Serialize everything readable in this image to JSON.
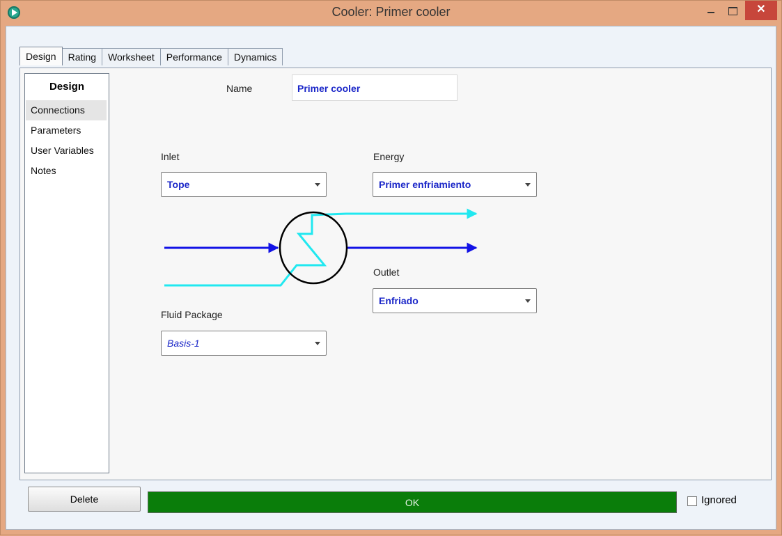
{
  "window": {
    "title": "Cooler: Primer cooler",
    "close_glyph": "✕"
  },
  "tabs": [
    {
      "label": "Design",
      "active": true
    },
    {
      "label": "Rating"
    },
    {
      "label": "Worksheet"
    },
    {
      "label": "Performance"
    },
    {
      "label": "Dynamics"
    }
  ],
  "nav": {
    "header": "Design",
    "items": [
      {
        "label": "Connections",
        "selected": true
      },
      {
        "label": "Parameters"
      },
      {
        "label": "User Variables"
      },
      {
        "label": "Notes"
      }
    ]
  },
  "form": {
    "name_label": "Name",
    "name_value": "Primer cooler",
    "inlet_label": "Inlet",
    "inlet_value": "Tope",
    "energy_label": "Energy",
    "energy_value": "Primer enfriamiento",
    "outlet_label": "Outlet",
    "outlet_value": "Enfriado",
    "fluid_package_label": "Fluid Package",
    "fluid_package_value": "Basis-1"
  },
  "footer": {
    "delete_label": "Delete",
    "status_text": "OK",
    "status_color": "#0a7d0a",
    "ignored_label": "Ignored",
    "ignored_checked": false
  },
  "colors": {
    "process_stream": "#1212e6",
    "energy_stream": "#21e8f0",
    "title_bar": "#e5a882"
  }
}
